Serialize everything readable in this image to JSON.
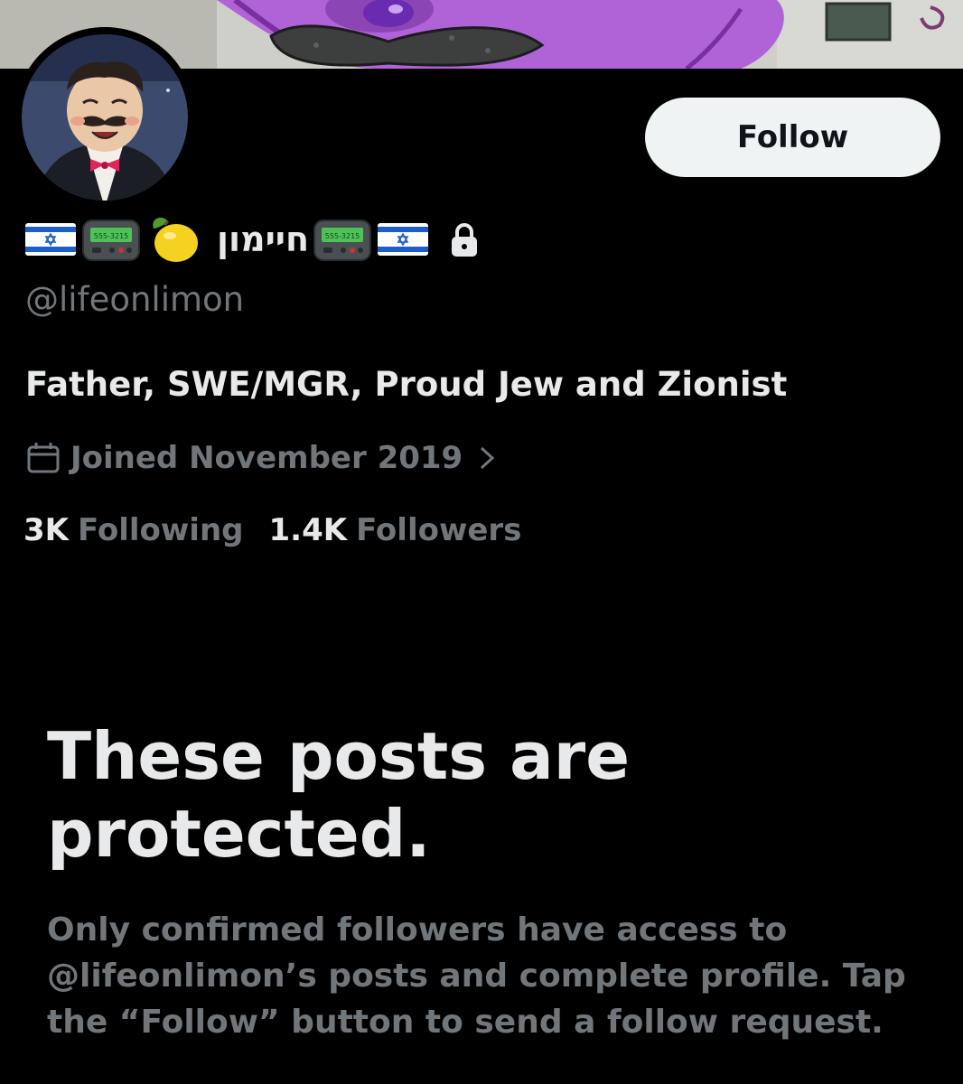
{
  "profile": {
    "display_name_hebrew": "חיימון",
    "handle": "@lifeonlimon",
    "bio": "Father, SWE/MGR, Proud Jew and Zionist",
    "joined": "Joined November 2019",
    "pager_text": "555-3215",
    "protected_icon": "lock-icon"
  },
  "actions": {
    "follow_label": "Follow"
  },
  "stats": {
    "following_count": "3K",
    "following_label": "Following",
    "followers_count": "1.4K",
    "followers_label": "Followers"
  },
  "protected_notice": {
    "title_line1": "These posts are",
    "title_line2": "protected.",
    "body": "Only confirmed followers have access to @lifeonlimon’s posts and complete profile. Tap the “Follow” button to send a follow request."
  },
  "colors": {
    "background": "#000000",
    "primary_text": "#e7e9ea",
    "secondary_text": "#71767b",
    "button_bg": "#eff3f4",
    "button_text": "#0f1419",
    "flag_blue": "#1d5ec7",
    "banner_purple": "#b063d6"
  },
  "icons": [
    "israel-flag-icon",
    "pager-icon",
    "lemon-icon",
    "lock-icon",
    "calendar-icon",
    "chevron-right-icon"
  ]
}
